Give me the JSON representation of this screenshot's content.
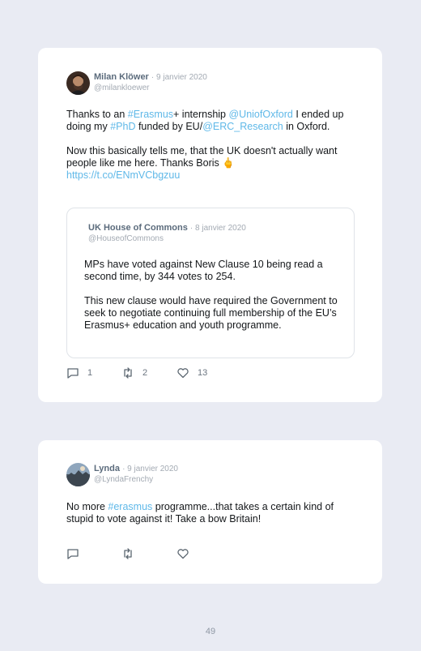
{
  "tweets": [
    {
      "author": "Milan Klöwer",
      "date": "· 9 janvier 2020",
      "handle": "@milankloewer",
      "paragraph1": [
        {
          "t": "Thanks to an ",
          "link": false
        },
        {
          "t": "#Erasmus",
          "link": true
        },
        {
          "t": "+ internship ",
          "link": false
        },
        {
          "t": "@UniofOxford",
          "link": true
        },
        {
          "t": " I ended up doing my ",
          "link": false
        },
        {
          "t": "#PhD",
          "link": true
        },
        {
          "t": " funded by EU/",
          "link": false
        },
        {
          "t": "@ERC_Research",
          "link": true
        },
        {
          "t": " in Oxford.",
          "link": false
        }
      ],
      "paragraph2": [
        {
          "t": "Now this basically tells me, that the UK doesn't actually want people like me here. Thanks Boris 🖕",
          "link": false
        }
      ],
      "paragraph3": [
        {
          "t": "https://t.co/ENmVCbgzuu",
          "link": true
        }
      ],
      "quote": {
        "author": "UK House of Commons",
        "date": "· 8 janvier 2020",
        "handle": "@HouseofCommons",
        "paragraph1": "MPs have voted against New Clause 10 being read a second time, by 344 votes to 254.",
        "paragraph2": "This new clause would have required the Government to seek to negotiate continuing full membership of the EU’s Erasmus+ education and youth programme."
      },
      "actions": {
        "replies": "1",
        "retweets": "2",
        "likes": "13"
      }
    },
    {
      "author": "Lynda",
      "date": "· 9 janvier 2020",
      "handle": "@LyndaFrenchy",
      "paragraph1": [
        {
          "t": "No more ",
          "link": false
        },
        {
          "t": "#erasmus",
          "link": true
        },
        {
          "t": " programme...that takes a certain kind of stupid to vote against it! Take a bow Britain!",
          "link": false
        }
      ],
      "actions": {
        "replies": "",
        "retweets": "",
        "likes": ""
      }
    }
  ],
  "page_number": "49",
  "colors": {
    "link": "#5fb8e8",
    "name": "#5b6b7c",
    "muted": "#a3aab3",
    "background": "#e9ebf3"
  },
  "icons": [
    "reply-icon",
    "retweet-icon",
    "like-icon"
  ]
}
